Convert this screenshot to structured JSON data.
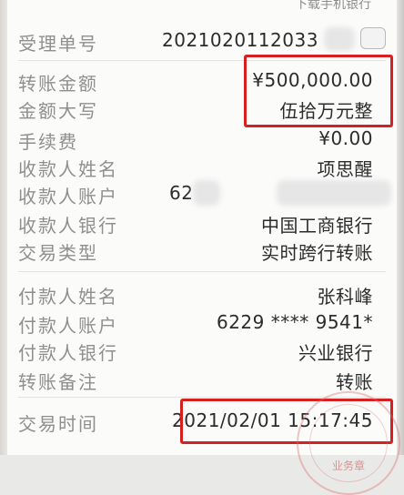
{
  "header": {
    "caption": "下载手机银行"
  },
  "fields": {
    "receipt_no": {
      "label": "受理单号",
      "value": "2021020112033"
    },
    "amount": {
      "label": "转账金额",
      "value": "¥500,000.00"
    },
    "amount_upper": {
      "label": "金额大写",
      "value": "伍拾万元整"
    },
    "fee": {
      "label": "手续费",
      "value": "¥0.00"
    },
    "payee_name": {
      "label": "收款人姓名",
      "value": "项思醒"
    },
    "payee_account": {
      "label": "收款人账户",
      "value": "62"
    },
    "payee_bank": {
      "label": "收款人银行",
      "value": "中国工商银行"
    },
    "tx_type": {
      "label": "交易类型",
      "value": "实时跨行转账"
    },
    "payer_name": {
      "label": "付款人姓名",
      "value": "张科峰"
    },
    "payer_account": {
      "label": "付款人账户",
      "value": "6229 **** 9541*"
    },
    "payer_bank": {
      "label": "付款人银行",
      "value": "兴业银行"
    },
    "remark": {
      "label": "转账备注",
      "value": "转账"
    },
    "tx_time": {
      "label": "交易时间",
      "value": "2021/02/01 15:17:45"
    }
  },
  "stamp": {
    "text": "业务章"
  },
  "highlight_color": "#d81f1f"
}
